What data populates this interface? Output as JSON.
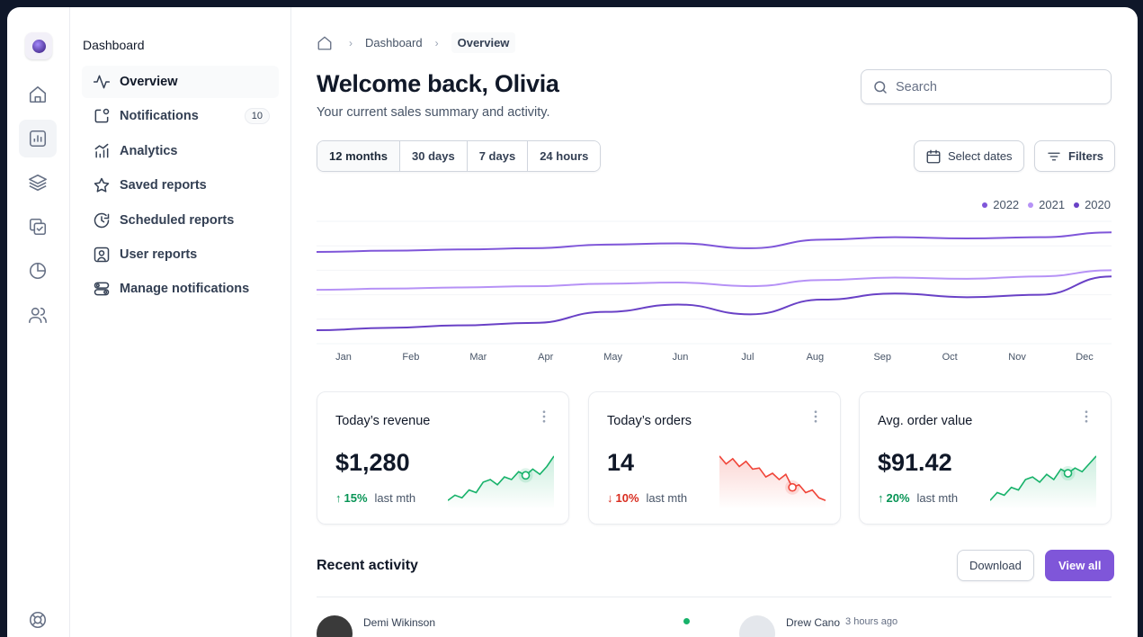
{
  "nav": {
    "section_title": "Dashboard",
    "items": [
      {
        "label": "Overview",
        "icon": "activity-icon"
      },
      {
        "label": "Notifications",
        "icon": "notification-icon",
        "badge": "10"
      },
      {
        "label": "Analytics",
        "icon": "analytics-icon"
      },
      {
        "label": "Saved reports",
        "icon": "star-icon"
      },
      {
        "label": "Scheduled reports",
        "icon": "clock-refresh-icon"
      },
      {
        "label": "User reports",
        "icon": "user-square-icon"
      },
      {
        "label": "Manage notifications",
        "icon": "toggles-icon"
      }
    ]
  },
  "rail": {
    "icons": [
      "home-icon",
      "bar-chart-icon",
      "layers-icon",
      "check-copy-icon",
      "pie-chart-icon",
      "users-icon",
      "life-buoy-icon"
    ]
  },
  "breadcrumb": {
    "items": [
      "Dashboard",
      "Overview"
    ]
  },
  "header": {
    "title": "Welcome back, Olivia",
    "subtitle": "Your current sales summary and activity."
  },
  "search": {
    "placeholder": "Search"
  },
  "filters": {
    "ranges": [
      "12 months",
      "30 days",
      "7 days",
      "24 hours"
    ],
    "selected": "12 months",
    "select_dates": "Select dates",
    "filters": "Filters"
  },
  "chart_data": {
    "type": "line",
    "x": [
      "Jan",
      "Feb",
      "Mar",
      "Apr",
      "May",
      "Jun",
      "Jul",
      "Aug",
      "Sep",
      "Oct",
      "Nov",
      "Dec"
    ],
    "legend_position": "top-right",
    "grid": true,
    "ylim": [
      0,
      1
    ],
    "series": [
      {
        "name": "2022",
        "color": "#7f56d9",
        "values": [
          0.75,
          0.76,
          0.77,
          0.78,
          0.81,
          0.82,
          0.78,
          0.85,
          0.87,
          0.86,
          0.87,
          0.91
        ]
      },
      {
        "name": "2021",
        "color": "#b692f6",
        "values": [
          0.44,
          0.45,
          0.46,
          0.47,
          0.49,
          0.5,
          0.47,
          0.52,
          0.54,
          0.53,
          0.55,
          0.6
        ]
      },
      {
        "name": "2020",
        "color": "#6941c6",
        "values": [
          0.11,
          0.13,
          0.15,
          0.17,
          0.26,
          0.32,
          0.24,
          0.36,
          0.41,
          0.38,
          0.4,
          0.55
        ]
      }
    ]
  },
  "stats": [
    {
      "title": "Today’s revenue",
      "value": "$1,280",
      "arrow": "↑",
      "delta": "15%",
      "delta_label": "last mth",
      "trend": "up",
      "spark": [
        0.1,
        0.2,
        0.15,
        0.3,
        0.25,
        0.45,
        0.5,
        0.4,
        0.55,
        0.5,
        0.65,
        0.58,
        0.7,
        0.6,
        0.75,
        0.95
      ]
    },
    {
      "title": "Today’s orders",
      "value": "14",
      "arrow": "↓",
      "delta": "10%",
      "delta_label": "last mth",
      "trend": "down",
      "spark": [
        0.95,
        0.8,
        0.9,
        0.75,
        0.85,
        0.7,
        0.72,
        0.55,
        0.62,
        0.5,
        0.6,
        0.35,
        0.4,
        0.25,
        0.3,
        0.15,
        0.1
      ]
    },
    {
      "title": "Avg. order value",
      "value": "$91.42",
      "arrow": "↑",
      "delta": "20%",
      "delta_label": "last mth",
      "trend": "up",
      "spark": [
        0.1,
        0.25,
        0.2,
        0.35,
        0.3,
        0.5,
        0.55,
        0.45,
        0.6,
        0.5,
        0.7,
        0.62,
        0.72,
        0.65,
        0.8,
        0.95
      ]
    }
  ],
  "activity": {
    "title": "Recent activity",
    "download": "Download",
    "view_all": "View all",
    "entries": [
      {
        "name": "Demi Wikinson",
        "time": ""
      },
      {
        "name": "Drew Cano",
        "time": "3 hours ago"
      }
    ]
  }
}
